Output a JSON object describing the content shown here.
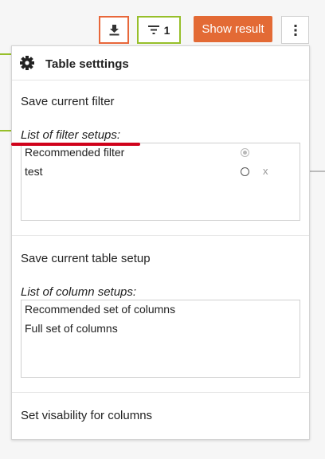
{
  "toolbar": {
    "download_icon": "download-icon",
    "filter_icon": "filter-icon",
    "filter_count": "1",
    "show_result_label": "Show result",
    "more_icon": "vertical-dots-icon"
  },
  "panel": {
    "title": "Table setttings",
    "save_filter_label": "Save current filter",
    "filter_setups_label": "List of filter setups:",
    "filter_setups": [
      {
        "label": "Recommended filter",
        "selected": true
      },
      {
        "label": "test",
        "selected": false,
        "delete_label": "x"
      }
    ],
    "save_table_setup_label": "Save current table setup",
    "column_setups_label": "List of column setups:",
    "column_setups": [
      {
        "label": "Recommended set of columns"
      },
      {
        "label": "Full set of columns"
      }
    ],
    "set_visibility_label": "Set visability for columns"
  },
  "colors": {
    "accent_orange": "#e36a35",
    "accent_green": "#97bf2a",
    "annotation_red": "#d0021b"
  }
}
